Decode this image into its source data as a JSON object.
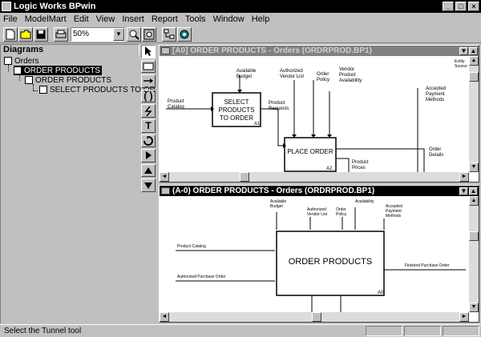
{
  "app": {
    "title": "Logic Works BPwin"
  },
  "menu": [
    "File",
    "ModelMart",
    "Edit",
    "View",
    "Insert",
    "Report",
    "Tools",
    "Window",
    "Help"
  ],
  "toolbar": {
    "zoom_value": "50%"
  },
  "diagrams_panel": {
    "title": "Diagrams",
    "tree": [
      {
        "label": "Orders",
        "level": 0
      },
      {
        "label": "ORDER PRODUCTS",
        "level": 1,
        "selected": true
      },
      {
        "label": "ORDER PRODUCTS",
        "level": 2
      },
      {
        "label": "SELECT PRODUCTS TO OR",
        "level": 3
      }
    ]
  },
  "window1": {
    "title": "[A0] ORDER PRODUCTS - Orders  (ORDRPROD.BP1)",
    "boxes": [
      {
        "label_lines": [
          "SELECT",
          "PRODUCTS",
          "TO ORDER"
        ],
        "number": "A1"
      },
      {
        "label_lines": [
          "PLACE ORDER"
        ],
        "number": "A2"
      }
    ],
    "labels": {
      "available_budget": [
        "Available",
        "Budget"
      ],
      "authorized_vendor_list": [
        "Authorized",
        "Vendor List"
      ],
      "order_policy": [
        "Order",
        "Policy"
      ],
      "vendor_product_availability": [
        "Vendor",
        "Product",
        "Availability"
      ],
      "product_catalog": [
        "Product",
        "Catalog"
      ],
      "product_requests": [
        "Product",
        "Requests"
      ],
      "accepted_payment_methods": [
        "Accepted",
        "Payment",
        "Methods"
      ],
      "order_details": [
        "Order",
        "Details"
      ],
      "product_prices": [
        "Product",
        "Prices"
      ],
      "entity_source_partial": [
        "Entity",
        "Source"
      ]
    }
  },
  "window2": {
    "title": "(A-0) ORDER PRODUCTS - Orders  (ORDRPROD.BP1)",
    "box": {
      "label": "ORDER PRODUCTS",
      "number": "A0"
    },
    "labels": {
      "available_budget": [
        "Available",
        "Budget"
      ],
      "authorized_vendor_list": [
        "Authorized",
        "Vendor List"
      ],
      "order_policy": [
        "Order",
        "Policy"
      ],
      "availability": [
        "Availability"
      ],
      "accepted_payment_methods": [
        "Accepted",
        "Payment",
        "Methods"
      ],
      "product_catalog": "Product Catalog",
      "authorized_purchase_order": "Authorized Purchase Order",
      "finished_purchase_order": "Finished Purchase Order"
    }
  },
  "status": {
    "message": "Select the Tunnel tool"
  }
}
